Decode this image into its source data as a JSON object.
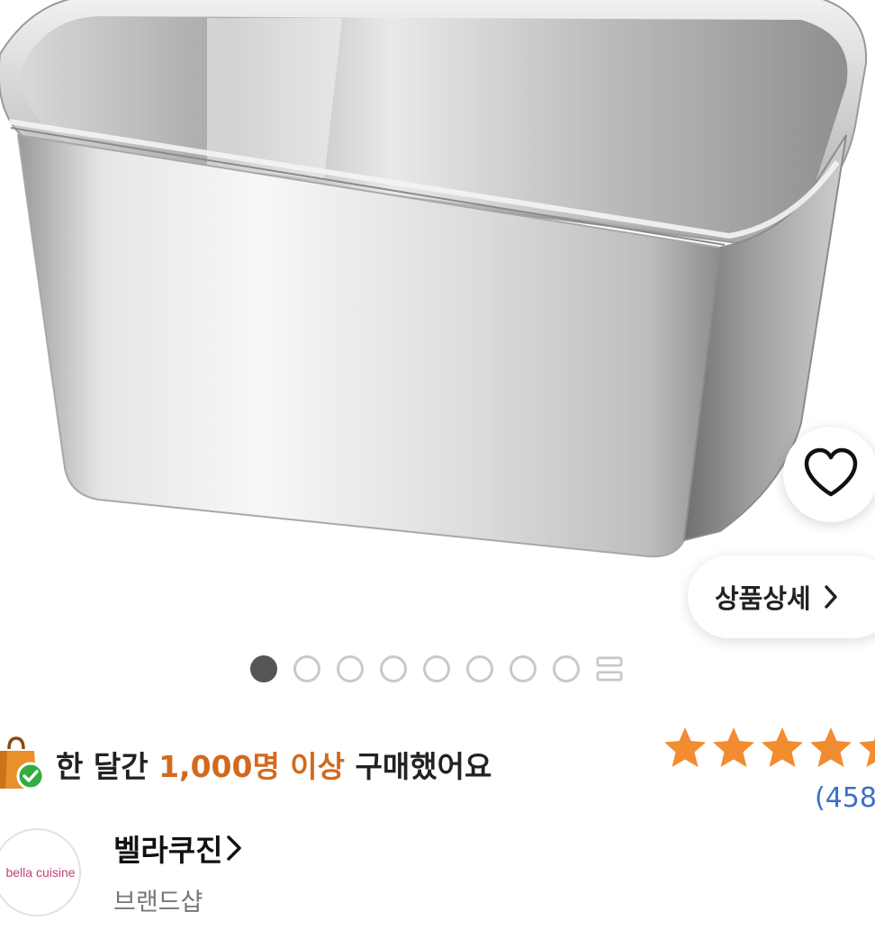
{
  "product": {
    "image_alt": "stainless steel rectangular container",
    "wish_icon": "heart-outline-icon",
    "detail_button_label": "상품상세"
  },
  "gallery": {
    "total_dots": 8,
    "active_index": 0,
    "grid_icon": "grid-view-icon"
  },
  "purchase_badge": {
    "icon": "shopping-bag-check-icon",
    "prefix": "한 달간",
    "highlight": "1,000명 이상",
    "suffix": "구매했어요",
    "highlight_color": "#d2691e"
  },
  "rating": {
    "stars": 5,
    "star_color": "#f28c30",
    "review_count_text": "(458"
  },
  "brand": {
    "logo_text": "bella cuisine",
    "name": "벨라쿠진",
    "subtitle": "브랜드샵"
  }
}
